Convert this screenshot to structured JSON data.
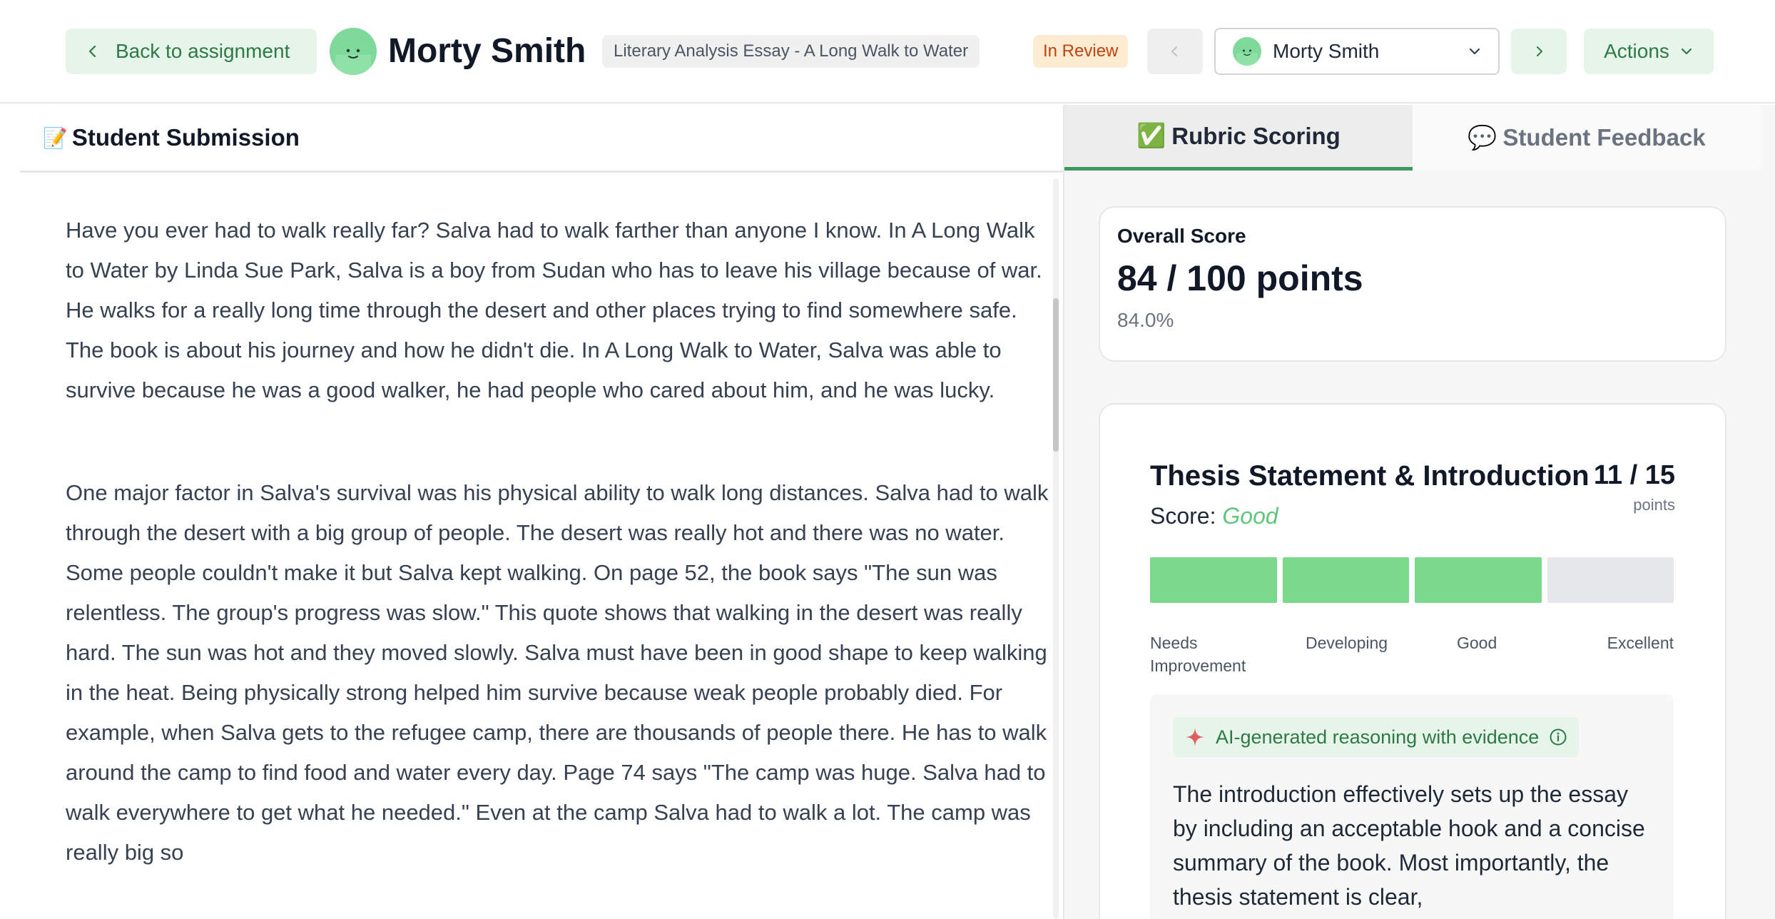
{
  "header": {
    "back_label": "Back to assignment",
    "student_name": "Morty Smith",
    "assignment_title": "Literary Analysis Essay - A Long Walk to Water",
    "status": "In Review",
    "student_select_value": "Morty Smith",
    "actions_label": "Actions"
  },
  "submission": {
    "emoji": "📝",
    "heading": "Student Submission",
    "paragraphs": [
      "Have you ever had to walk really far? Salva had to walk farther than anyone I know. In A Long Walk to Water by Linda Sue Park, Salva is a boy from Sudan who has to leave his village because of war. He walks for a really long time through the desert and other places trying to find somewhere safe. The book is about his journey and how he didn't die. In A Long Walk to Water, Salva was able to survive because he was a good walker, he had people who cared about him, and he was lucky.",
      "One major factor in Salva's survival was his physical ability to walk long distances. Salva had to walk through the desert with a big group of people. The desert was really hot and there was no water. Some people couldn't make it but Salva kept walking. On page 52, the book says \"The sun was relentless. The group's progress was slow.\" This quote shows that walking in the desert was really hard. The sun was hot and they moved slowly. Salva must have been in good shape to keep walking in the heat. Being physically strong helped him survive because weak people probably died. For example, when Salva gets to the refugee camp, there are thousands of people there. He has to walk around the camp to find food and water every day. Page 74 says \"The camp was huge. Salva had to walk everywhere to get what he needed.\" Even at the camp Salva had to walk a lot. The camp was really big so"
    ]
  },
  "tabs": {
    "rubric": {
      "emoji": "✅",
      "label": "Rubric Scoring"
    },
    "feedback": {
      "emoji": "💬",
      "label": "Student Feedback"
    }
  },
  "overall": {
    "label": "Overall Score",
    "score": "84 / 100 points",
    "percent": "84.0%"
  },
  "criterion": {
    "title": "Thesis Statement & Introduction",
    "points": "11 / 15",
    "points_unit": "points",
    "score_prefix": "Score:",
    "score_level": "Good",
    "levels": [
      "Needs Improvement",
      "Developing",
      "Good",
      "Excellent"
    ],
    "selected_level_count": 3,
    "ai_label": "AI-generated reasoning with evidence",
    "reasoning": "The introduction effectively sets up the essay by including an acceptable hook and a concise summary of the book. Most importantly, the thesis statement is clear,"
  },
  "colors": {
    "accent_green": "#2d7a46",
    "level_fill": "#7ad98d",
    "status_orange": "#c2410c",
    "status_bg": "#fdecd2"
  },
  "icons": {
    "back": "chevron-left-icon",
    "prev": "chevron-left-icon",
    "next": "chevron-right-icon",
    "dropdown": "chevron-down-icon",
    "ai": "sparkle-icon",
    "info": "info-icon"
  }
}
